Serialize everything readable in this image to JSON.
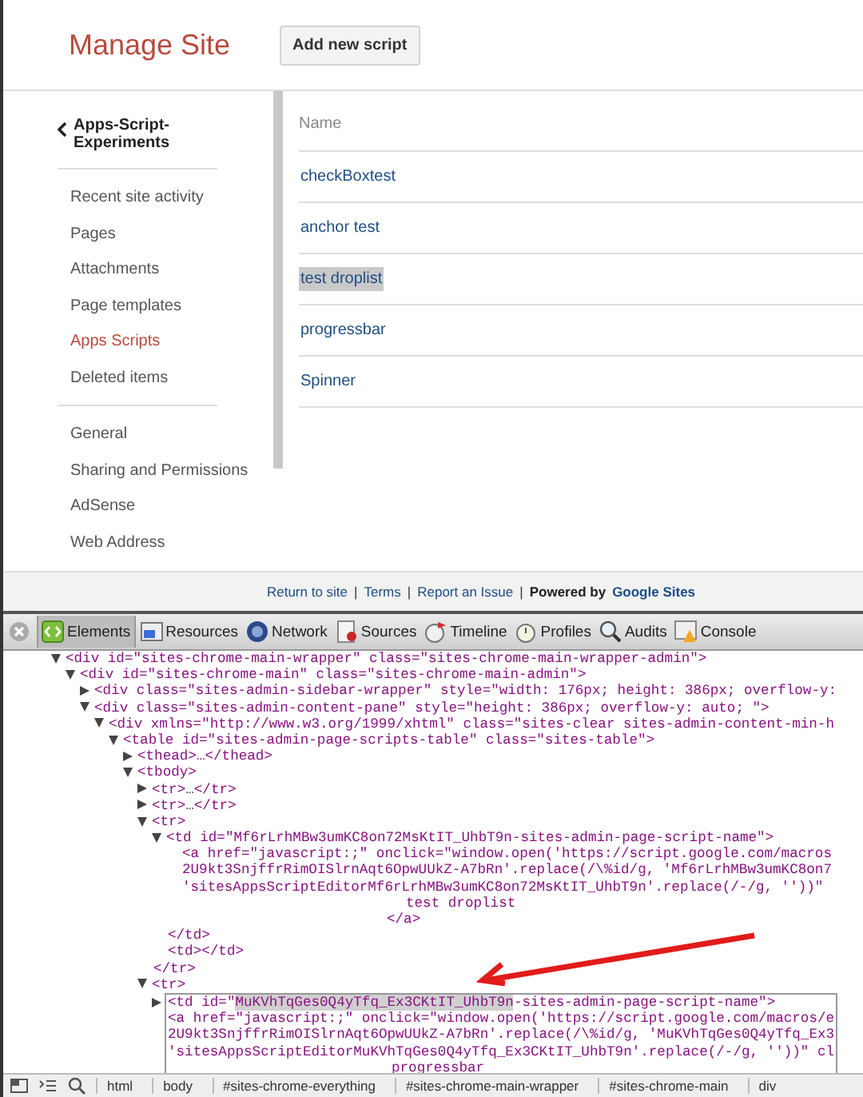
{
  "header": {
    "title": "Manage Site",
    "add_button": "Add new script"
  },
  "sidebar": {
    "back_label": "Apps-Script-Experiments",
    "groups": [
      [
        {
          "label": "Recent site activity",
          "selected": false
        },
        {
          "label": "Pages",
          "selected": false
        },
        {
          "label": "Attachments",
          "selected": false
        },
        {
          "label": "Page templates",
          "selected": false
        },
        {
          "label": "Apps Scripts",
          "selected": true
        },
        {
          "label": "Deleted items",
          "selected": false
        }
      ],
      [
        {
          "label": "General",
          "selected": false
        },
        {
          "label": "Sharing and Permissions",
          "selected": false
        },
        {
          "label": "AdSense",
          "selected": false
        },
        {
          "label": "Web Address",
          "selected": false
        }
      ]
    ]
  },
  "scripts_table": {
    "column": "Name",
    "rows": [
      {
        "name": "checkBoxtest",
        "selected": false
      },
      {
        "name": "anchor test",
        "selected": false
      },
      {
        "name": "test droplist",
        "selected": true
      },
      {
        "name": "progressbar",
        "selected": false
      },
      {
        "name": "Spinner",
        "selected": false
      }
    ]
  },
  "footer": {
    "links": [
      "Return to site",
      "Terms",
      "Report an Issue"
    ],
    "separator": "|",
    "powered_by": "Powered by",
    "brand_link": "Google Sites"
  },
  "devtools": {
    "tabs": [
      {
        "label": "Elements",
        "selected": true
      },
      {
        "label": "Resources",
        "selected": false
      },
      {
        "label": "Network",
        "selected": false
      },
      {
        "label": "Sources",
        "selected": false
      },
      {
        "label": "Timeline",
        "selected": false
      },
      {
        "label": "Profiles",
        "selected": false
      },
      {
        "label": "Audits",
        "selected": false
      },
      {
        "label": "Console",
        "selected": false
      }
    ],
    "dom_tree": [
      {
        "kind": "tag",
        "text": "<div id=\"sites-chrome-main-wrapper\" class=\"sites-chrome-main-wrapper-admin\">",
        "expanded": true,
        "children": [
          {
            "kind": "tag",
            "text": "<div id=\"sites-chrome-main\" class=\"sites-chrome-main-admin\">",
            "expanded": true,
            "children": [
              {
                "kind": "tag",
                "text": "<div class=\"sites-admin-sidebar-wrapper\" style=\"width: 176px; height: 386px; overflow-y:",
                "expanded": false
              },
              {
                "kind": "tag",
                "text": "<div class=\"sites-admin-content-pane\" style=\"height: 386px; overflow-y: auto; \">",
                "expanded": true,
                "children": [
                  {
                    "kind": "tag",
                    "text": "<div xmlns=\"http://www.w3.org/1999/xhtml\" class=\"sites-clear sites-admin-content-min-h",
                    "expanded": true,
                    "children": [
                      {
                        "kind": "tag",
                        "text": "<table id=\"sites-admin-page-scripts-table\" class=\"sites-table\">",
                        "expanded": true,
                        "children": [
                          {
                            "kind": "tag",
                            "text": "<thead>…</thead>",
                            "expanded": false
                          },
                          {
                            "kind": "tag",
                            "text": "<tbody>",
                            "expanded": true,
                            "children": [
                              {
                                "kind": "tag",
                                "text": "<tr>…</tr>",
                                "expanded": false
                              },
                              {
                                "kind": "tag",
                                "text": "<tr>…</tr>",
                                "expanded": false
                              },
                              {
                                "kind": "tag",
                                "text": "<tr>",
                                "expanded": true,
                                "children": [
                                  {
                                    "kind": "tag",
                                    "text": "<td id=\"Mf6rLrhMBw3umKC8on72MsKtIT_UhbT9n-sites-admin-page-script-name\">",
                                    "expanded": true,
                                    "children": [
                                      {
                                        "kind": "line",
                                        "text": "<a href=\"javascript:;\" onclick=\"window.open('https://script.google.com/macros"
                                      },
                                      {
                                        "kind": "line",
                                        "text": "2U9kt3SnjffrRimOISlrnAqt6OpwUUkZ-A7bRn'.replace(/\\%id/g, 'Mf6rLrhMBw3umKC8on7"
                                      },
                                      {
                                        "kind": "line",
                                        "text": "'sitesAppsScriptEditorMf6rLrhMBw3umKC8on72MsKtIT_UhbT9n'.replace(/-/g, ''))\""
                                      },
                                      {
                                        "kind": "inner",
                                        "text": "test droplist"
                                      },
                                      {
                                        "kind": "inner_close",
                                        "text": "</a>"
                                      }
                                    ]
                                  },
                                  {
                                    "kind": "line",
                                    "text": "</td>"
                                  },
                                  {
                                    "kind": "line",
                                    "text": "<td></td>"
                                  }
                                ]
                              },
                              {
                                "kind": "line",
                                "text": "</tr>"
                              },
                              {
                                "kind": "tag",
                                "text": "<tr>",
                                "expanded": true,
                                "children": [
                                  {
                                    "kind": "tag",
                                    "selected": true,
                                    "expanded": false,
                                    "text_before": "<td id=\"",
                                    "highlight": "MuKVhTqGes0Q4yTfq_Ex3CKtIT_UhbT9n",
                                    "text_after": "-sites-admin-page-script-name\">",
                                    "preview": [
                                      {
                                        "kind": "line",
                                        "text": "<a href=\"javascript:;\" onclick=\"window.open('https://script.google.com/macros/e"
                                      },
                                      {
                                        "kind": "line",
                                        "text": "2U9kt3SnjffrRimOISlrnAqt6OpwUUkZ-A7bRn'.replace(/\\%id/g, 'MuKVhTqGes0Q4yTfq_Ex3"
                                      },
                                      {
                                        "kind": "line",
                                        "text": "'sitesAppsScriptEditorMuKVhTqGes0Q4yTfq_Ex3CKtIT_UhbT9n'.replace(/-/g, ''))\" cl"
                                      },
                                      {
                                        "kind": "inner",
                                        "text": "progressbar"
                                      }
                                    ]
                                  }
                                ]
                              }
                            ]
                          }
                        ]
                      }
                    ]
                  }
                ]
              }
            ]
          }
        ]
      }
    ],
    "breadcrumbs": [
      "html",
      "body",
      "#sites-chrome-everything",
      "#sites-chrome-main-wrapper",
      "#sites-chrome-main",
      "div"
    ]
  }
}
